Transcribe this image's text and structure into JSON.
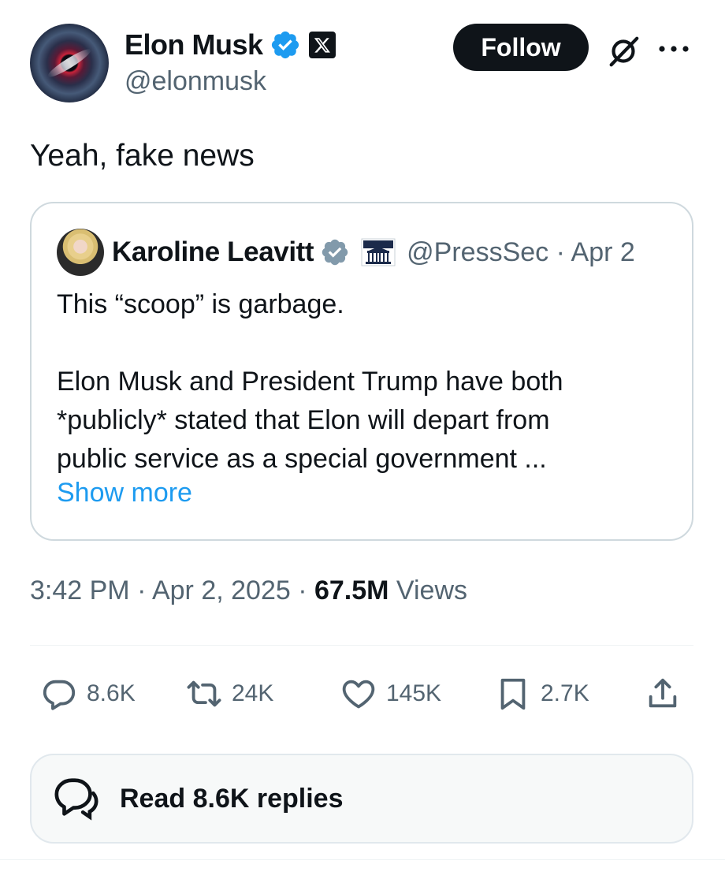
{
  "author": {
    "display_name": "Elon Musk",
    "handle": "@elonmusk",
    "verified_badge_color": "#1d9bf0",
    "affiliate_badge": "x-logo-icon"
  },
  "actions_header": {
    "follow_label": "Follow",
    "grok_icon": "grok-icon",
    "more_icon": "more-icon"
  },
  "tweet": {
    "text": "Yeah, fake news"
  },
  "quote": {
    "display_name": "Karoline Leavitt",
    "badge_color": "#829aab",
    "affiliate_icon": "white-house-icon",
    "handle": "@PressSec",
    "separator": "·",
    "date": "Apr 2",
    "line1": "This “scoop” is garbage.",
    "line2": "Elon Musk and President Trump have both",
    "line3": "*publicly* stated that Elon will depart from",
    "line4": "public service as a special government ...",
    "show_more": "Show more"
  },
  "meta": {
    "time": "3:42 PM",
    "sep1": " · ",
    "date": "Apr 2, 2025",
    "sep2": " · ",
    "views_count": "67.5M",
    "views_label": " Views"
  },
  "engagement": {
    "replies": "8.6K",
    "reposts": "24K",
    "likes": "145K",
    "bookmarks": "2.7K",
    "share_icon": "share-icon"
  },
  "read_replies": {
    "label": "Read 8.6K replies"
  },
  "colors": {
    "text": "#0f1419",
    "secondary": "#536471",
    "link": "#1d9bf0",
    "border": "#cfd9de"
  }
}
